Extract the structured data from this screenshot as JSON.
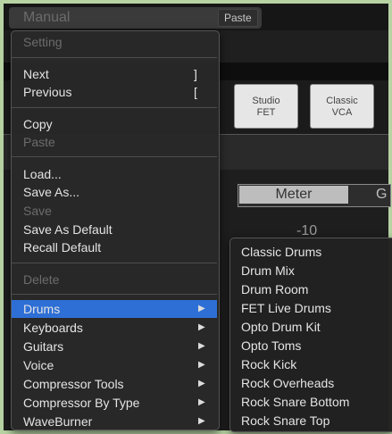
{
  "preset_selector": {
    "value": "Manual",
    "chevron": "chevron-down-icon"
  },
  "toolbar": {
    "paste_label": "Paste"
  },
  "model_buttons": [
    {
      "label": "Studio\nFET"
    },
    {
      "label": "Classic\nVCA"
    }
  ],
  "view_toggle": {
    "meter_label": "Meter",
    "gain_label": "Gain",
    "gain_visible": "G"
  },
  "meter_scale": {
    "tick": "-10"
  },
  "context_menu": {
    "items": [
      {
        "label": "Setting",
        "enabled": false
      },
      {
        "label": "Next",
        "shortcut": "]",
        "enabled": true
      },
      {
        "label": "Previous",
        "shortcut": "[",
        "enabled": true
      },
      {
        "label": "Copy",
        "enabled": true
      },
      {
        "label": "Paste",
        "enabled": false
      },
      {
        "label": "Load...",
        "enabled": true
      },
      {
        "label": "Save As...",
        "enabled": true
      },
      {
        "label": "Save",
        "enabled": false
      },
      {
        "label": "Save As Default",
        "enabled": true
      },
      {
        "label": "Recall Default",
        "enabled": true
      },
      {
        "label": "Delete",
        "enabled": false
      },
      {
        "label": "Drums",
        "enabled": true,
        "submenu": true,
        "highlighted": true
      },
      {
        "label": "Keyboards",
        "enabled": true,
        "submenu": true
      },
      {
        "label": "Guitars",
        "enabled": true,
        "submenu": true
      },
      {
        "label": "Voice",
        "enabled": true,
        "submenu": true
      },
      {
        "label": "Compressor Tools",
        "enabled": true,
        "submenu": true
      },
      {
        "label": "Compressor By Type",
        "enabled": true,
        "submenu": true
      },
      {
        "label": "WaveBurner",
        "enabled": true,
        "submenu": true
      }
    ],
    "highlight_color": "#2e6fd6"
  },
  "drums_submenu": {
    "items": [
      "Classic Drums",
      "Drum Mix",
      "Drum Room",
      "FET Live Drums",
      "Opto Drum Kit",
      "Opto Toms",
      "Rock Kick",
      "Rock Overheads",
      "Rock Snare Bottom",
      "Rock Snare Top"
    ]
  },
  "colors": {
    "background": "#161616",
    "frame": "#b7d3a3",
    "menu_text": "#e4e4e4",
    "disabled_text": "#6c6c6c"
  }
}
